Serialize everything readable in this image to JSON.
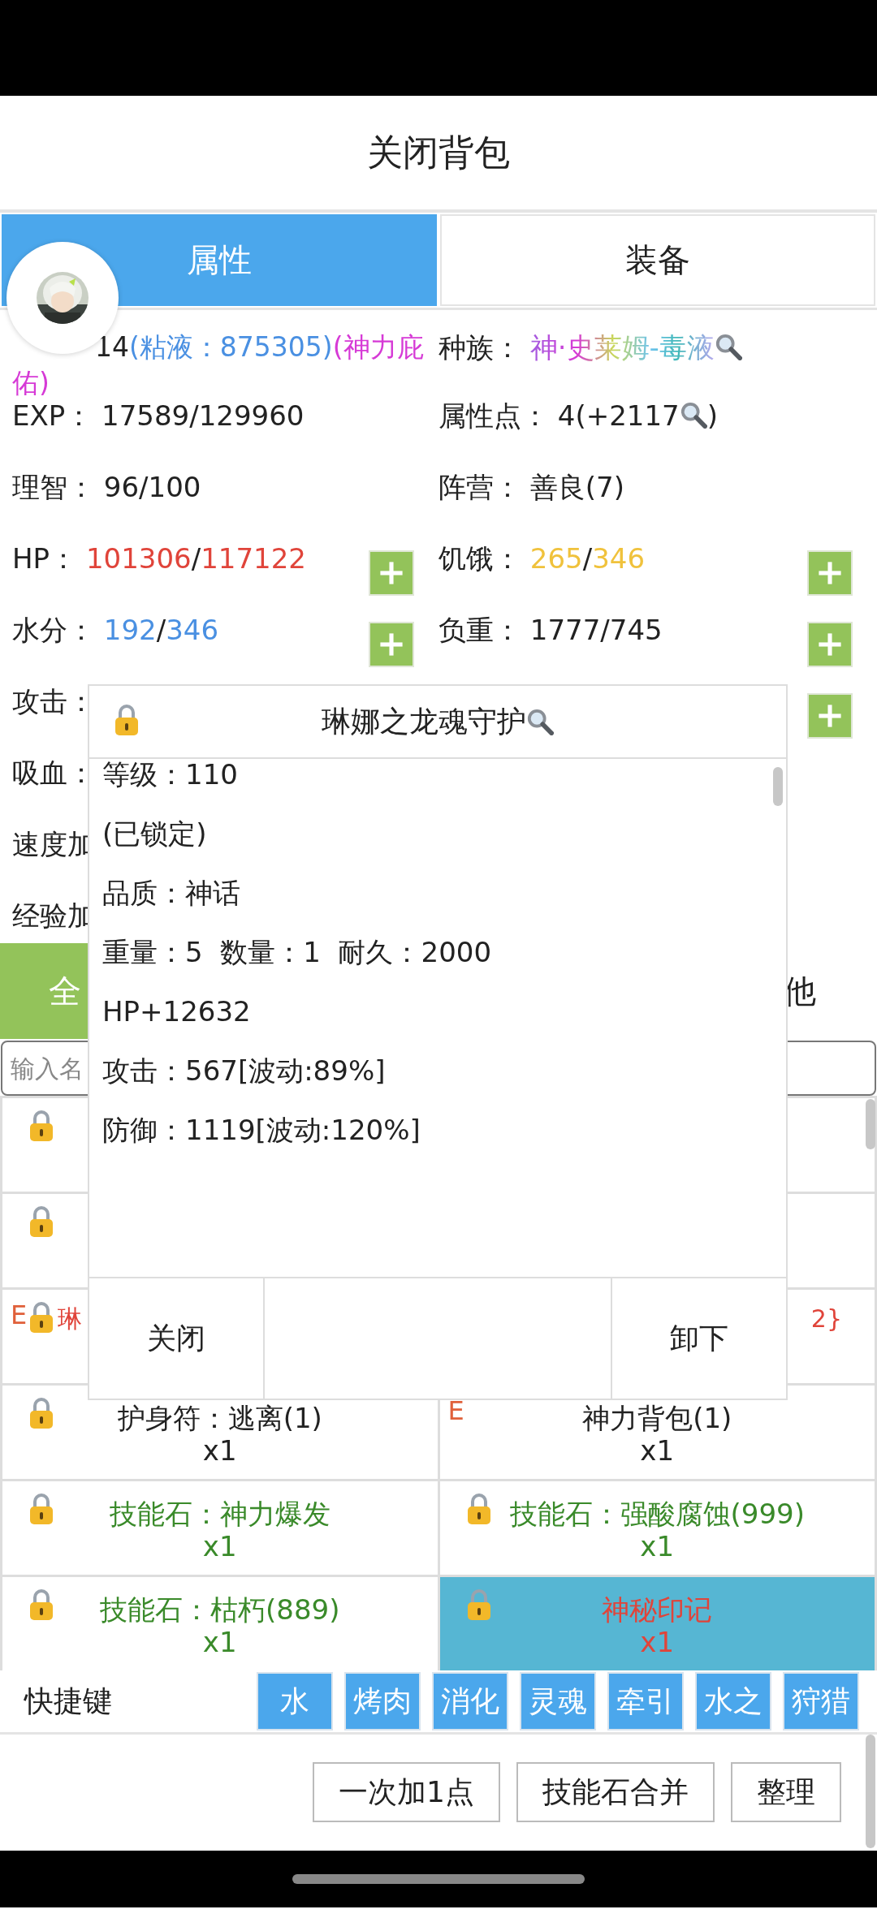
{
  "title": "关闭背包",
  "tabs": [
    {
      "label": "属性",
      "selected": true
    },
    {
      "label": "装备",
      "selected": false
    }
  ],
  "avatar": {
    "kind": "picture"
  },
  "stats": [
    {
      "left": {
        "covered": true,
        "parts": [
          {
            "text": "14",
            "color": "#222222"
          },
          {
            "text": "(粘液：875305)",
            "color": "#4a90e2"
          },
          {
            "text": "(神力庇",
            "color": "#d63ad6"
          },
          {
            "text": "佑)",
            "color": "#d63ad6"
          }
        ]
      },
      "right": {
        "label": "种族：",
        "parts": [
          {
            "text": "神·史莱姆-毒液",
            "gradient": true,
            "search": true
          }
        ]
      }
    },
    {
      "left": {
        "label": "EXP：",
        "parts": [
          {
            "text": "17589/129960",
            "color": "#222222"
          }
        ]
      },
      "right": {
        "label": "属性点：",
        "parts": [
          {
            "text": "4(+2117",
            "color": "#222222",
            "search": true
          },
          {
            "text": ")",
            "color": "#222222"
          }
        ]
      }
    },
    {
      "left": {
        "label": "理智：",
        "parts": [
          {
            "text": "96/100",
            "color": "#222222"
          }
        ]
      },
      "right": {
        "label": "阵营：",
        "parts": [
          {
            "text": "善良(7)",
            "color": "#222222"
          }
        ]
      }
    },
    {
      "left": {
        "label": "HP：",
        "parts": [
          {
            "text": "101306",
            "color": "#e0443a"
          },
          {
            "text": "/",
            "color": "#222222"
          },
          {
            "text": "117122",
            "color": "#e0443a"
          }
        ],
        "plus": true
      },
      "right": {
        "label": "饥饿：",
        "parts": [
          {
            "text": "265",
            "color": "#f0c23c"
          },
          {
            "text": "/",
            "color": "#222222"
          },
          {
            "text": "346",
            "color": "#f0c23c"
          }
        ],
        "plus": true
      }
    },
    {
      "left": {
        "label": "水分：",
        "parts": [
          {
            "text": "192",
            "color": "#4a90e2"
          },
          {
            "text": "/",
            "color": "#222222"
          },
          {
            "text": "346",
            "color": "#4a90e2"
          }
        ],
        "plus": true
      },
      "right": {
        "label": "负重：",
        "parts": [
          {
            "text": "1777/745",
            "color": "#222222"
          }
        ],
        "plus": true
      }
    },
    {
      "left": {
        "label": "攻击："
      },
      "right": {
        "plus": true
      }
    },
    {
      "left": {
        "label": "吸血："
      }
    },
    {
      "left": {
        "label": "速度加"
      }
    },
    {
      "left": {
        "label": "经验加"
      }
    }
  ],
  "category_tabs": [
    {
      "label": "全",
      "selected": true
    },
    {
      "label": "他",
      "selected": false
    }
  ],
  "search": {
    "placeholder": "输入名"
  },
  "items": [
    {
      "kind": "covered_left",
      "locked": true,
      "selected": false
    },
    {
      "kind": "covered_right",
      "selected": false
    },
    {
      "kind": "covered_left",
      "locked": true,
      "selected": false
    },
    {
      "kind": "covered_right",
      "selected": false
    },
    {
      "kind": "covered_left",
      "locked": true,
      "badge": "E",
      "name": "琳",
      "color": "#e0443a",
      "selected": false
    },
    {
      "kind": "covered_right",
      "name": "2}",
      "color": "#e0443a",
      "selected": false
    },
    {
      "kind": "full",
      "locked": true,
      "name": "护身符：逃离(1)",
      "count": "x1",
      "color": "#222222",
      "selected": false
    },
    {
      "kind": "full",
      "locked": false,
      "badge": "E",
      "name": "神力背包(1)",
      "count": "x1",
      "color": "#222222",
      "selected": false
    },
    {
      "kind": "full",
      "locked": true,
      "name": "技能石：神力爆发",
      "count": "x1",
      "color": "#3a8a2a",
      "selected": false
    },
    {
      "kind": "full",
      "locked": true,
      "name": "技能石：强酸腐蚀(999)",
      "count": "x1",
      "color": "#3a8a2a",
      "selected": false
    },
    {
      "kind": "full",
      "locked": true,
      "name": "技能石：枯朽(889)",
      "count": "x1",
      "color": "#3a8a2a",
      "selected": false
    },
    {
      "kind": "full",
      "locked": true,
      "name": "神秘印记",
      "count": "x1",
      "color": "#e0443a",
      "selected": true
    }
  ],
  "shortcuts": {
    "label": "快捷键",
    "keys": [
      "水",
      "烤肉",
      "消化",
      "灵魂",
      "牵引",
      "水之",
      "狩猎"
    ]
  },
  "actions": [
    "一次加1点",
    "技能石合并",
    "整理"
  ],
  "modal": {
    "title": "琳娜之龙魂守护",
    "locked": true,
    "search": true,
    "lines": [
      "等级：110",
      "(已锁定)",
      "品质：神话",
      "重量：5  数量：1  耐久：2000",
      "HP+12632",
      "攻击：567[波动:89%]",
      "防御：1119[波动:120%]"
    ],
    "buttons": [
      "关闭",
      "卸下"
    ]
  }
}
